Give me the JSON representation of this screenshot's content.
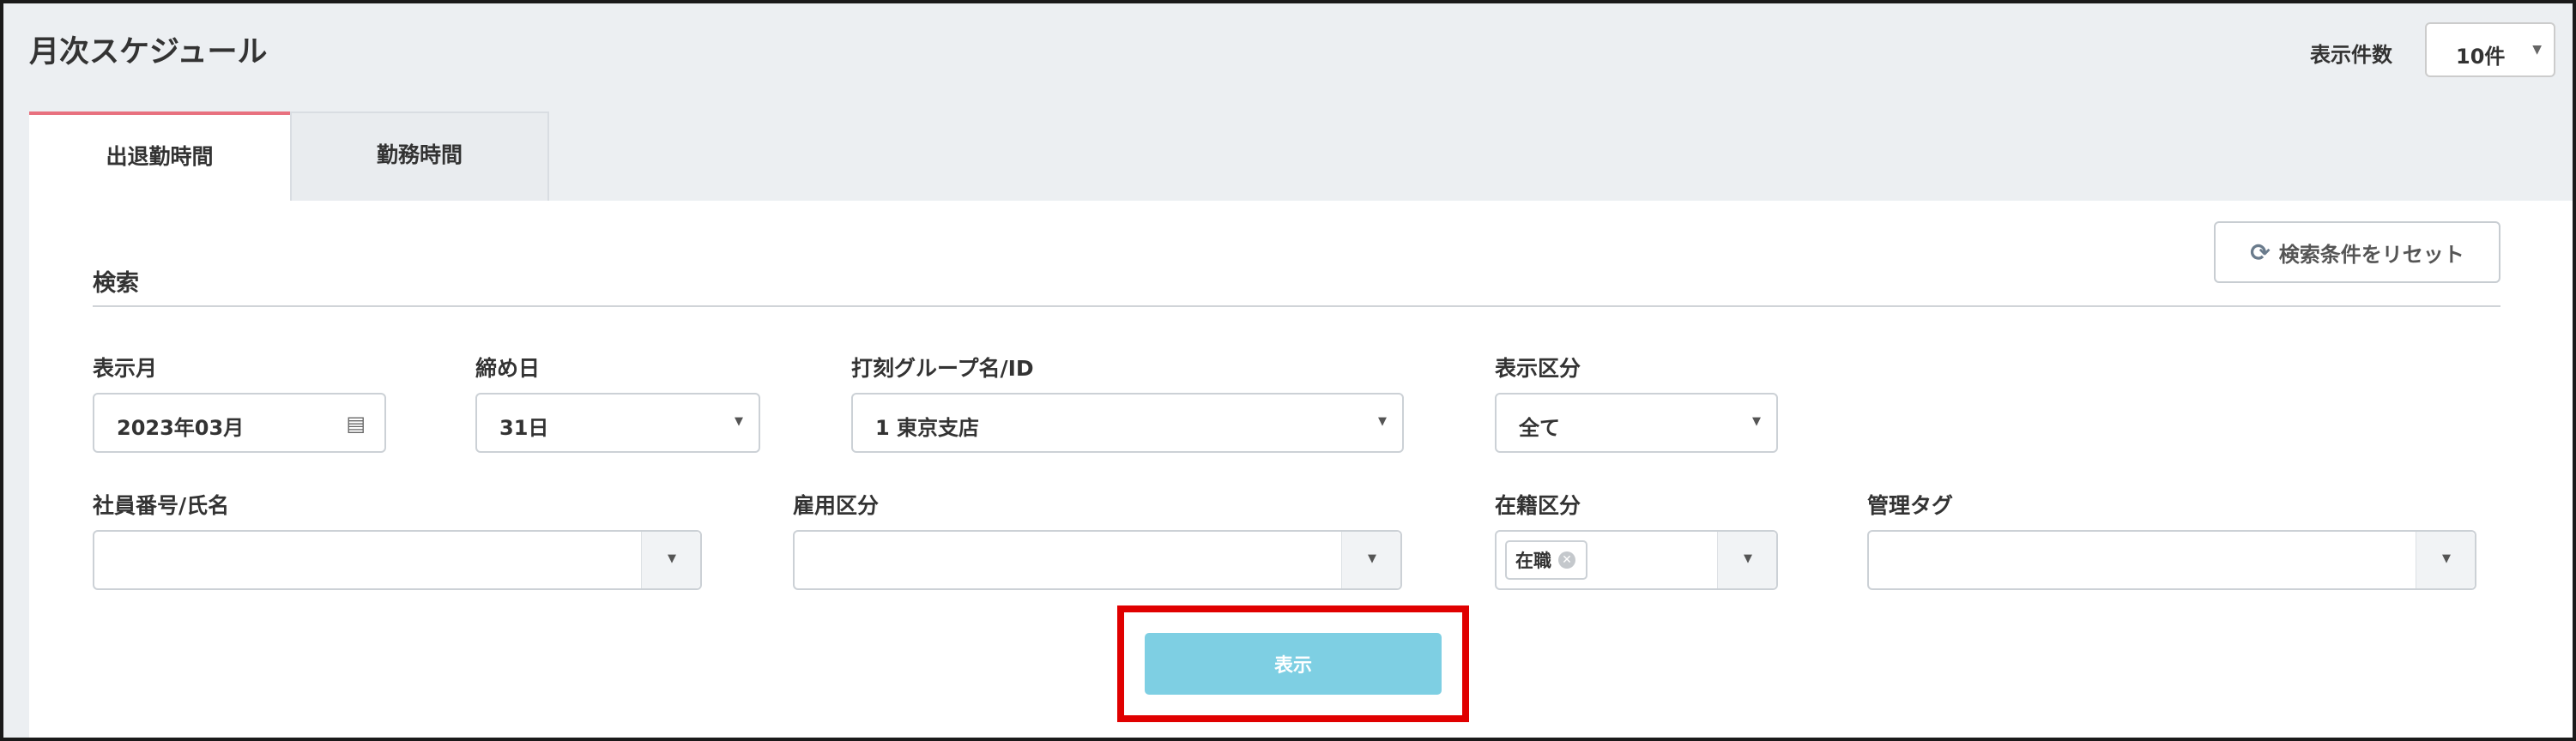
{
  "header": {
    "title": "月次スケジュール",
    "per_page_label": "表示件数",
    "per_page_value": "10件"
  },
  "tabs": [
    {
      "label": "出退勤時間",
      "active": true
    },
    {
      "label": "勤務時間",
      "active": false
    }
  ],
  "search": {
    "section_title": "検索",
    "reset_label": "検索条件をリセット",
    "fields": {
      "display_month": {
        "label": "表示月",
        "value": "2023年03月"
      },
      "closing_day": {
        "label": "締め日",
        "value": "31日"
      },
      "group": {
        "label": "打刻グループ名/ID",
        "value": "1 東京支店"
      },
      "display_type": {
        "label": "表示区分",
        "value": "全て"
      },
      "employee": {
        "label": "社員番号/氏名",
        "value": ""
      },
      "employment_type": {
        "label": "雇用区分",
        "value": ""
      },
      "enrollment": {
        "label": "在籍区分",
        "tag": "在職"
      },
      "management_tag": {
        "label": "管理タグ",
        "value": ""
      }
    },
    "submit_label": "表示"
  },
  "colors": {
    "tab_accent": "#e8717f",
    "submit_bg": "#7ecfe3",
    "highlight": "#e00000"
  }
}
